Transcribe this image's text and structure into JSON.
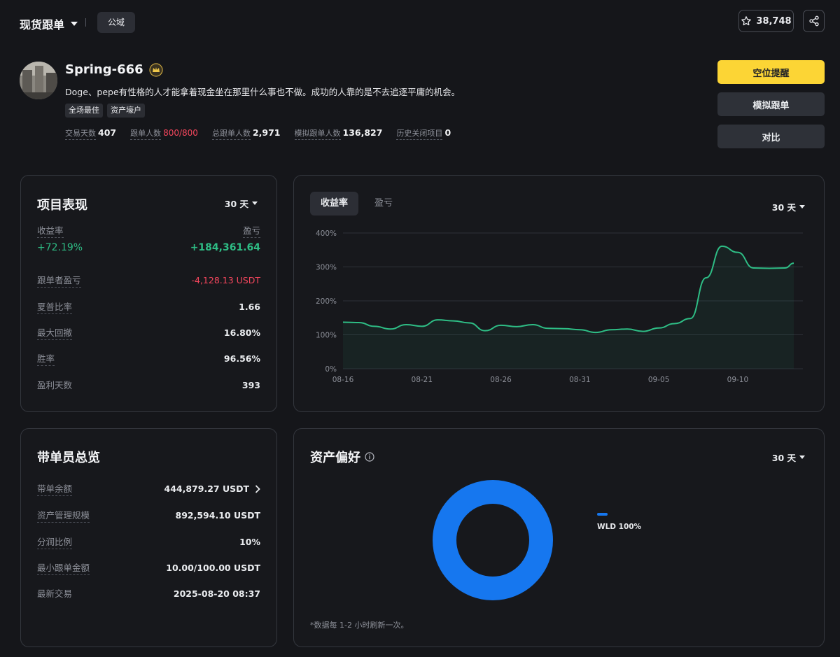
{
  "header": {
    "mode_label": "现货跟单",
    "domain_label": "公域",
    "favorites_count": "38,748"
  },
  "profile": {
    "name": "Spring-666",
    "bio": "Doge、pepe有性格的人才能拿着现金坐在那里什么事也不做。成功的人靠的是不去追逐平庸的机会。",
    "tags": [
      "全场最佳",
      "资产壕户"
    ],
    "stats": [
      {
        "label": "交易天数",
        "value": "407"
      },
      {
        "label": "跟单人数",
        "value": "800/800",
        "alert": true
      },
      {
        "label": "总跟单人数",
        "value": "2,971"
      },
      {
        "label": "模拟跟单人数",
        "value": "136,827"
      },
      {
        "label": "历史关闭项目",
        "value": "0"
      }
    ]
  },
  "actions": {
    "primary": "空位提醒",
    "simulate": "模拟跟单",
    "compare": "对比"
  },
  "performance": {
    "title": "项目表现",
    "period": "30 天",
    "roi_label": "收益率",
    "pnl_label": "盈亏",
    "roi_value": "+72.19%",
    "pnl_value": "+184,361.64",
    "rows": [
      {
        "label": "跟单者盈亏",
        "value": "-4,128.13 USDT"
      },
      {
        "label": "夏普比率",
        "value": "1.66"
      },
      {
        "label": "最大回撤",
        "value": "16.80%"
      },
      {
        "label": "胜率",
        "value": "96.56%"
      },
      {
        "label": "盈利天数",
        "value": "393"
      }
    ]
  },
  "roi_chart": {
    "tabs": [
      "收益率",
      "盈亏"
    ],
    "period": "30 天"
  },
  "chart_data": {
    "type": "area",
    "x_ticks": [
      "08-16",
      "08-21",
      "08-26",
      "08-31",
      "09-05",
      "09-10"
    ],
    "y_ticks": [
      "0%",
      "100%",
      "200%",
      "300%",
      "400%"
    ],
    "ylim": [
      0,
      400
    ],
    "grid": true,
    "color": "#2ebd85",
    "series": [
      {
        "x": [
          "08-16",
          "08-17",
          "08-18",
          "08-19",
          "08-20",
          "08-21",
          "08-22",
          "08-23",
          "08-24",
          "08-25",
          "08-26",
          "08-27",
          "08-28",
          "08-29",
          "08-30",
          "08-31",
          "09-01",
          "09-02",
          "09-03",
          "09-04",
          "09-05",
          "09-06",
          "09-07",
          "09-08",
          "09-09",
          "09-10",
          "09-11",
          "09-12",
          "09-13"
        ],
        "values": [
          137,
          136,
          125,
          117,
          130,
          125,
          144,
          141,
          135,
          112,
          128,
          124,
          130,
          119,
          118,
          115,
          107,
          115,
          117,
          110,
          120,
          133,
          148,
          268,
          361,
          343,
          297,
          296,
          297
        ]
      }
    ],
    "end_value": 311
  },
  "leader": {
    "title": "带单员总览",
    "rows": [
      {
        "label": "带单余额",
        "value": "444,879.27 USDT"
      },
      {
        "label": "资产管理规模",
        "value": "892,594.10 USDT"
      },
      {
        "label": "分润比例",
        "value": "10%"
      },
      {
        "label": "最小跟单金额",
        "value": "10.00/100.00 USDT"
      },
      {
        "label": "最新交易",
        "value": "2025-08-20 08:37"
      }
    ]
  },
  "asset_pref": {
    "title": "资产偏好",
    "period": "30 天",
    "footnote": "*数据每 1-2 小时刷新一次。",
    "legend": "WLD 100%",
    "slices": [
      {
        "name": "WLD",
        "percent": 100,
        "color": "#1677ef"
      }
    ]
  }
}
